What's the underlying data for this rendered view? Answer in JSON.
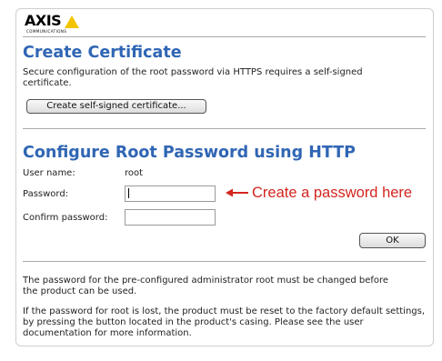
{
  "brand": {
    "logo_text": "AXIS",
    "logo_subtext": "COMMUNICATIONS",
    "accent_color": "#f2c500"
  },
  "certificate": {
    "title": "Create Certificate",
    "description": "Secure configuration of the root password via HTTPS requires a self-signed certificate.",
    "button_label": "Create self-signed certificate..."
  },
  "password_form": {
    "title": "Configure Root Password using HTTP",
    "username_label": "User name:",
    "username_value": "root",
    "password_label": "Password:",
    "password_value": "",
    "confirm_label": "Confirm password:",
    "confirm_value": "",
    "ok_label": "OK"
  },
  "annotation": {
    "text": "Create a password here",
    "color": "#d3261f"
  },
  "notes": {
    "paragraph1": "The password for the pre-configured administrator root must be changed before the product can be used.",
    "paragraph2": "If the password for root is lost, the product must be reset to the factory default settings, by pressing the button located in the product's casing. Please see the user documentation for more information."
  },
  "theme": {
    "heading_color": "#3066b4"
  }
}
